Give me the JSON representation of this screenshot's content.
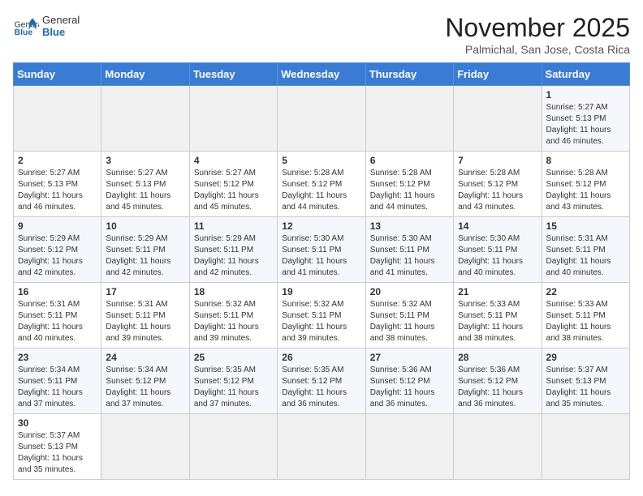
{
  "header": {
    "logo_general": "General",
    "logo_blue": "Blue",
    "month_title": "November 2025",
    "subtitle": "Palmichal, San Jose, Costa Rica"
  },
  "weekdays": [
    "Sunday",
    "Monday",
    "Tuesday",
    "Wednesday",
    "Thursday",
    "Friday",
    "Saturday"
  ],
  "days": [
    {
      "date": "",
      "empty": true
    },
    {
      "date": "",
      "empty": true
    },
    {
      "date": "",
      "empty": true
    },
    {
      "date": "",
      "empty": true
    },
    {
      "date": "",
      "empty": true
    },
    {
      "date": "",
      "empty": true
    },
    {
      "day": 1,
      "sunrise": "5:27 AM",
      "sunset": "5:13 PM",
      "daylight": "11 hours and 46 minutes."
    },
    {
      "day": 2,
      "sunrise": "5:27 AM",
      "sunset": "5:13 PM",
      "daylight": "11 hours and 46 minutes."
    },
    {
      "day": 3,
      "sunrise": "5:27 AM",
      "sunset": "5:13 PM",
      "daylight": "11 hours and 45 minutes."
    },
    {
      "day": 4,
      "sunrise": "5:27 AM",
      "sunset": "5:12 PM",
      "daylight": "11 hours and 45 minutes."
    },
    {
      "day": 5,
      "sunrise": "5:28 AM",
      "sunset": "5:12 PM",
      "daylight": "11 hours and 44 minutes."
    },
    {
      "day": 6,
      "sunrise": "5:28 AM",
      "sunset": "5:12 PM",
      "daylight": "11 hours and 44 minutes."
    },
    {
      "day": 7,
      "sunrise": "5:28 AM",
      "sunset": "5:12 PM",
      "daylight": "11 hours and 43 minutes."
    },
    {
      "day": 8,
      "sunrise": "5:28 AM",
      "sunset": "5:12 PM",
      "daylight": "11 hours and 43 minutes."
    },
    {
      "day": 9,
      "sunrise": "5:29 AM",
      "sunset": "5:12 PM",
      "daylight": "11 hours and 42 minutes."
    },
    {
      "day": 10,
      "sunrise": "5:29 AM",
      "sunset": "5:11 PM",
      "daylight": "11 hours and 42 minutes."
    },
    {
      "day": 11,
      "sunrise": "5:29 AM",
      "sunset": "5:11 PM",
      "daylight": "11 hours and 42 minutes."
    },
    {
      "day": 12,
      "sunrise": "5:30 AM",
      "sunset": "5:11 PM",
      "daylight": "11 hours and 41 minutes."
    },
    {
      "day": 13,
      "sunrise": "5:30 AM",
      "sunset": "5:11 PM",
      "daylight": "11 hours and 41 minutes."
    },
    {
      "day": 14,
      "sunrise": "5:30 AM",
      "sunset": "5:11 PM",
      "daylight": "11 hours and 40 minutes."
    },
    {
      "day": 15,
      "sunrise": "5:31 AM",
      "sunset": "5:11 PM",
      "daylight": "11 hours and 40 minutes."
    },
    {
      "day": 16,
      "sunrise": "5:31 AM",
      "sunset": "5:11 PM",
      "daylight": "11 hours and 40 minutes."
    },
    {
      "day": 17,
      "sunrise": "5:31 AM",
      "sunset": "5:11 PM",
      "daylight": "11 hours and 39 minutes."
    },
    {
      "day": 18,
      "sunrise": "5:32 AM",
      "sunset": "5:11 PM",
      "daylight": "11 hours and 39 minutes."
    },
    {
      "day": 19,
      "sunrise": "5:32 AM",
      "sunset": "5:11 PM",
      "daylight": "11 hours and 39 minutes."
    },
    {
      "day": 20,
      "sunrise": "5:32 AM",
      "sunset": "5:11 PM",
      "daylight": "11 hours and 38 minutes."
    },
    {
      "day": 21,
      "sunrise": "5:33 AM",
      "sunset": "5:11 PM",
      "daylight": "11 hours and 38 minutes."
    },
    {
      "day": 22,
      "sunrise": "5:33 AM",
      "sunset": "5:11 PM",
      "daylight": "11 hours and 38 minutes."
    },
    {
      "day": 23,
      "sunrise": "5:34 AM",
      "sunset": "5:11 PM",
      "daylight": "11 hours and 37 minutes."
    },
    {
      "day": 24,
      "sunrise": "5:34 AM",
      "sunset": "5:12 PM",
      "daylight": "11 hours and 37 minutes."
    },
    {
      "day": 25,
      "sunrise": "5:35 AM",
      "sunset": "5:12 PM",
      "daylight": "11 hours and 37 minutes."
    },
    {
      "day": 26,
      "sunrise": "5:35 AM",
      "sunset": "5:12 PM",
      "daylight": "11 hours and 36 minutes."
    },
    {
      "day": 27,
      "sunrise": "5:36 AM",
      "sunset": "5:12 PM",
      "daylight": "11 hours and 36 minutes."
    },
    {
      "day": 28,
      "sunrise": "5:36 AM",
      "sunset": "5:12 PM",
      "daylight": "11 hours and 36 minutes."
    },
    {
      "day": 29,
      "sunrise": "5:37 AM",
      "sunset": "5:13 PM",
      "daylight": "11 hours and 35 minutes."
    },
    {
      "day": 30,
      "sunrise": "5:37 AM",
      "sunset": "5:13 PM",
      "daylight": "11 hours and 35 minutes."
    },
    {
      "date": "",
      "empty": true
    },
    {
      "date": "",
      "empty": true
    },
    {
      "date": "",
      "empty": true
    },
    {
      "date": "",
      "empty": true
    },
    {
      "date": "",
      "empty": true
    },
    {
      "date": "",
      "empty": true
    }
  ]
}
